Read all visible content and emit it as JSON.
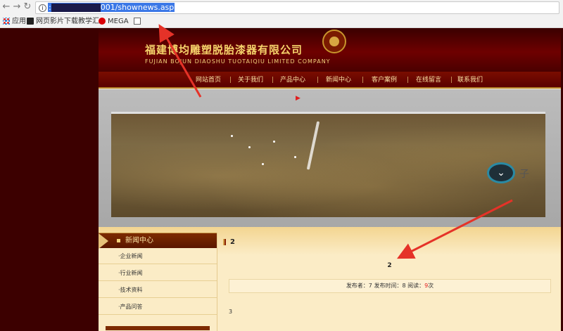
{
  "browser": {
    "nav_back": "←",
    "nav_forward": "→",
    "nav_reload": "↻",
    "url_prefix": ":",
    "url_visible": "001/shownews.asp",
    "bookmarks": [
      {
        "label": "应用",
        "icon": "apps-icon"
      },
      {
        "label": "网页影片下载教学汇",
        "icon": "video-icon"
      },
      {
        "label": "MEGA",
        "icon": "mega-icon"
      },
      {
        "label": "",
        "icon": "page-icon"
      }
    ]
  },
  "site": {
    "company_cn": "福建博均雕塑脱胎漆器有限公司",
    "company_en": "FUJIAN BOJUN DIAOSHU TUOTAIQIU LIMITED COMPANY",
    "nav": [
      "网站首页",
      "关于我们",
      "产品中心",
      "新闻中心",
      "客户案例",
      "在线留言",
      "联系我们"
    ],
    "nav_separator": "|",
    "banner_badge_text": "子",
    "sidebar": {
      "title": "新闻中心",
      "items": [
        "·企业新闻",
        "·行业新闻",
        "·技术资料",
        "·产品问答"
      ]
    },
    "article": {
      "section_title": "2",
      "headline": "2",
      "meta_prefix": "发布者：7 发布时间：8 阅读：",
      "views": "9",
      "meta_suffix": "次",
      "body": "3"
    }
  },
  "colors": {
    "accent_red": "#e01e1e",
    "nav_gold": "#fbe3a4",
    "background_dark": "#3c0000",
    "cream": "#fbecc6"
  }
}
